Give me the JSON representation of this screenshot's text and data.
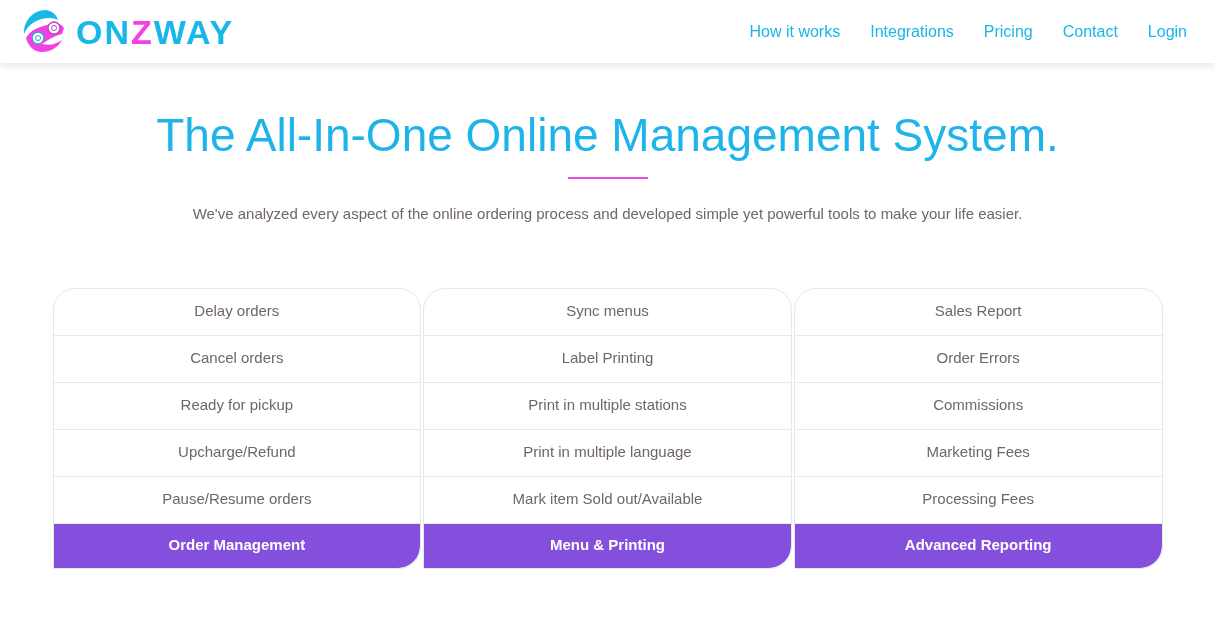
{
  "logo": {
    "parts": [
      {
        "text": "ON",
        "color": "#19b6ea"
      },
      {
        "text": "Z",
        "color": "#f53fe6"
      },
      {
        "text": "WAY",
        "color": "#19b6ea"
      }
    ]
  },
  "nav": [
    "How it works",
    "Integrations",
    "Pricing",
    "Contact",
    "Login"
  ],
  "hero": {
    "title": "The All-In-One Online Management System.",
    "subtitle": "We've analyzed every aspect of the online ordering process and developed simple yet powerful tools to make your life easier."
  },
  "features": [
    {
      "items": [
        "Delay orders",
        "Cancel orders",
        "Ready for pickup",
        "Upcharge/Refund",
        "Pause/Resume orders"
      ],
      "footer": "Order Management"
    },
    {
      "items": [
        "Sync menus",
        "Label Printing",
        "Print in multiple stations",
        "Print in multiple language",
        "Mark item Sold out/Available"
      ],
      "footer": "Menu & Printing"
    },
    {
      "items": [
        "Sales Report",
        "Order Errors",
        "Commissions",
        "Marketing Fees",
        "Processing Fees"
      ],
      "footer": "Advanced Reporting"
    }
  ]
}
